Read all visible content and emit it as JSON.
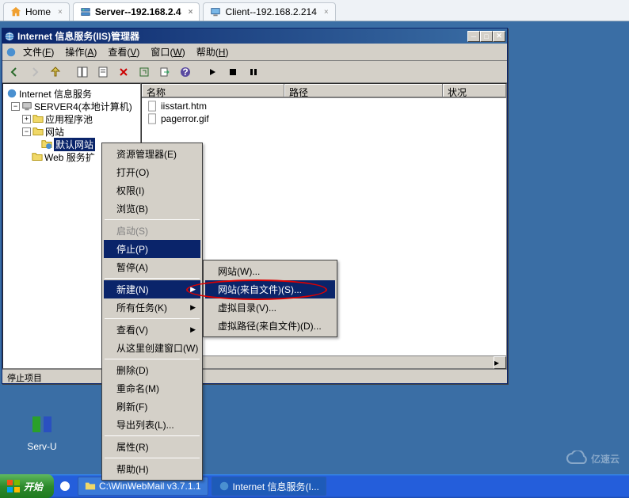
{
  "browserTabs": [
    {
      "label": "Home",
      "icon": "home",
      "active": false
    },
    {
      "label": "Server--192.168.2.4",
      "icon": "server",
      "active": true
    },
    {
      "label": "Client--192.168.2.214",
      "icon": "client",
      "active": false
    }
  ],
  "window": {
    "title": "Internet 信息服务(IIS)管理器",
    "menuBar": [
      {
        "label": "文件",
        "accel": "F"
      },
      {
        "label": "操作",
        "accel": "A"
      },
      {
        "label": "查看",
        "accel": "V"
      },
      {
        "label": "窗口",
        "accel": "W"
      },
      {
        "label": "帮助",
        "accel": "H"
      }
    ],
    "statusBar": "停止项目"
  },
  "tree": {
    "root": "Internet 信息服务",
    "server": "SERVER4(本地计算机)",
    "nodes": [
      {
        "label": "应用程序池",
        "expand": "+",
        "indent": 2
      },
      {
        "label": "网站",
        "expand": "-",
        "indent": 2
      },
      {
        "label": "默认网站",
        "expand": null,
        "indent": 3,
        "selected": true,
        "fragment": true
      },
      {
        "label": "Web 服务扩",
        "expand": null,
        "indent": 2,
        "truncated": true
      }
    ]
  },
  "listHeader": {
    "name": "名称",
    "path": "路径",
    "status": "状况"
  },
  "listRows": [
    {
      "file": "iisstart.htm"
    },
    {
      "file": "pagerror.gif"
    }
  ],
  "contextMenu1": [
    {
      "label": "资源管理器",
      "accel": "E"
    },
    {
      "label": "打开",
      "accel": "O"
    },
    {
      "label": "权限",
      "accel": "I"
    },
    {
      "label": "浏览",
      "accel": "B"
    },
    {
      "type": "sep"
    },
    {
      "label": "启动",
      "accel": "S",
      "disabled": true
    },
    {
      "label": "停止",
      "accel": "P",
      "highlight": true
    },
    {
      "label": "暂停",
      "accel": "A"
    },
    {
      "type": "sep"
    },
    {
      "label": "新建",
      "accel": "N",
      "submenu": true,
      "highlight": true
    },
    {
      "label": "所有任务",
      "accel": "K",
      "submenu": true
    },
    {
      "type": "sep"
    },
    {
      "label": "查看",
      "accel": "V",
      "submenu": true
    },
    {
      "label": "从这里创建窗口",
      "accel": "W"
    },
    {
      "type": "sep"
    },
    {
      "label": "删除",
      "accel": "D"
    },
    {
      "label": "重命名",
      "accel": "M"
    },
    {
      "label": "刷新",
      "accel": "F"
    },
    {
      "label": "导出列表",
      "accel": "L",
      "ellipsis": true
    },
    {
      "type": "sep"
    },
    {
      "label": "属性",
      "accel": "R"
    },
    {
      "type": "sep"
    },
    {
      "label": "帮助",
      "accel": "H"
    }
  ],
  "contextMenu2": [
    {
      "label": "网站",
      "accel": "W",
      "ellipsis": true
    },
    {
      "label": "网站(来自文件)",
      "accel": "S",
      "ellipsis": true,
      "highlight": true
    },
    {
      "label": "虚拟目录",
      "accel": "V",
      "ellipsis": true
    },
    {
      "label": "虚拟路径(来自文件)",
      "accel": "D",
      "ellipsis": true
    }
  ],
  "desktopIcon": {
    "label": "Serv-U"
  },
  "taskbar": {
    "start": "开始",
    "items": [
      {
        "label": "C:\\WinWebMail v3.7.1.1",
        "active": false
      },
      {
        "label": "Internet 信息服务(I...",
        "active": true
      }
    ]
  },
  "watermark": "亿速云"
}
